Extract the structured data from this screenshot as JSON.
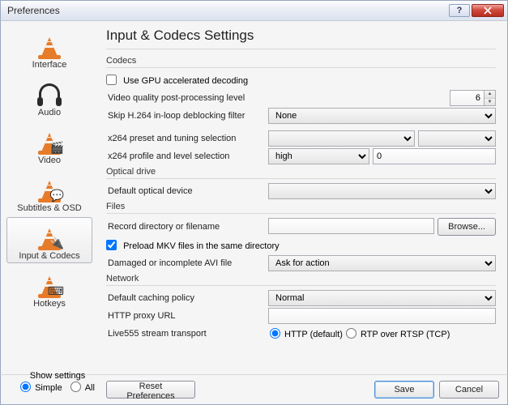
{
  "window": {
    "title": "Preferences"
  },
  "sidebar": {
    "items": [
      {
        "label": "Interface"
      },
      {
        "label": "Audio"
      },
      {
        "label": "Video"
      },
      {
        "label": "Subtitles & OSD"
      },
      {
        "label": "Input & Codecs"
      },
      {
        "label": "Hotkeys"
      }
    ]
  },
  "main": {
    "heading": "Input & Codecs Settings",
    "codecs": {
      "legend": "Codecs",
      "gpu_label": "Use GPU accelerated decoding",
      "gpu_checked": false,
      "postproc_label": "Video quality post-processing level",
      "postproc_value": "6",
      "skip_label": "Skip H.264 in-loop deblocking filter",
      "skip_value": "None",
      "x264_preset_label": "x264 preset and tuning selection",
      "x264_preset_value": "",
      "x264_tuning_value": "",
      "x264_profile_label": "x264 profile and level selection",
      "x264_profile_value": "high",
      "x264_level_value": "0"
    },
    "optical": {
      "legend": "Optical drive",
      "device_label": "Default optical device",
      "device_value": ""
    },
    "files": {
      "legend": "Files",
      "record_label": "Record directory or filename",
      "record_value": "",
      "browse_label": "Browse...",
      "preload_label": "Preload MKV files in the same directory",
      "preload_checked": true,
      "avi_label": "Damaged or incomplete AVI file",
      "avi_value": "Ask for action"
    },
    "network": {
      "legend": "Network",
      "caching_label": "Default caching policy",
      "caching_value": "Normal",
      "proxy_label": "HTTP proxy URL",
      "proxy_value": "",
      "live555_label": "Live555 stream transport",
      "live555_http": "HTTP (default)",
      "live555_rtp": "RTP over RTSP (TCP)"
    }
  },
  "footer": {
    "show_settings": "Show settings",
    "simple": "Simple",
    "all": "All",
    "reset": "Reset Preferences",
    "save": "Save",
    "cancel": "Cancel"
  }
}
